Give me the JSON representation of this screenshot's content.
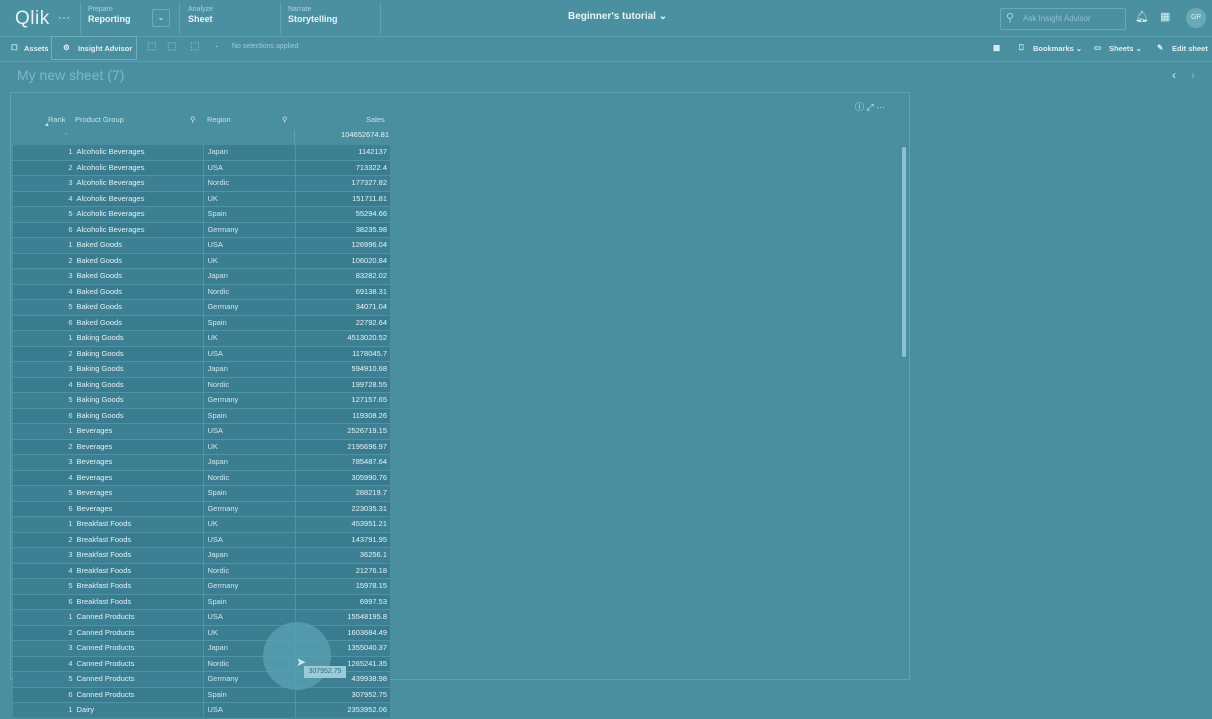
{
  "app": {
    "logo": "Qlik",
    "menu_dots": "···",
    "nav": [
      {
        "small": "Prepare",
        "main": "Reporting"
      },
      {
        "small": "Analyze",
        "main": "Sheet"
      },
      {
        "small": "Narrate",
        "main": "Storytelling"
      }
    ],
    "dropdown_arrow": "⌄",
    "title": "Beginner's tutorial ⌄",
    "search_placeholder": "Ask Insight Advisor",
    "avatar_initials": "GP"
  },
  "toolbar": {
    "assets": "Assets",
    "insight_advisor": "Insight Advisor",
    "no_selections": "No selections applied",
    "bookmarks": "Bookmarks ⌄",
    "sheets": "Sheets ⌄",
    "edit_sheet": "Edit sheet"
  },
  "sheet": {
    "title": "My new sheet (7)"
  },
  "table": {
    "headers": {
      "rank": "Rank",
      "product_group": "Product Group",
      "region": "Region",
      "sales": "Sales"
    },
    "total": "104652674.81",
    "total_dash": "-",
    "rows": [
      [
        "1",
        "Alcoholic Beverages",
        "Japan",
        "1142137"
      ],
      [
        "2",
        "Alcoholic Beverages",
        "USA",
        "713322.4"
      ],
      [
        "3",
        "Alcoholic Beverages",
        "Nordic",
        "177327.82"
      ],
      [
        "4",
        "Alcoholic Beverages",
        "UK",
        "151711.81"
      ],
      [
        "5",
        "Alcoholic Beverages",
        "Spain",
        "55294.66"
      ],
      [
        "6",
        "Alcoholic Beverages",
        "Germany",
        "38235.98"
      ],
      [
        "1",
        "Baked Goods",
        "USA",
        "126996.04"
      ],
      [
        "2",
        "Baked Goods",
        "UK",
        "106020.84"
      ],
      [
        "3",
        "Baked Goods",
        "Japan",
        "83282.02"
      ],
      [
        "4",
        "Baked Goods",
        "Nordic",
        "69138.31"
      ],
      [
        "5",
        "Baked Goods",
        "Germany",
        "34071.04"
      ],
      [
        "6",
        "Baked Goods",
        "Spain",
        "22792.64"
      ],
      [
        "1",
        "Baking Goods",
        "UK",
        "4513020.52"
      ],
      [
        "2",
        "Baking Goods",
        "USA",
        "1178045.7"
      ],
      [
        "3",
        "Baking Goods",
        "Japan",
        "594910.68"
      ],
      [
        "4",
        "Baking Goods",
        "Nordic",
        "199728.55"
      ],
      [
        "5",
        "Baking Goods",
        "Germany",
        "127157.65"
      ],
      [
        "6",
        "Baking Goods",
        "Spain",
        "119308.26"
      ],
      [
        "1",
        "Beverages",
        "USA",
        "2526719.15"
      ],
      [
        "2",
        "Beverages",
        "UK",
        "2195696.97"
      ],
      [
        "3",
        "Beverages",
        "Japan",
        "785487.64"
      ],
      [
        "4",
        "Beverages",
        "Nordic",
        "305990.76"
      ],
      [
        "5",
        "Beverages",
        "Spain",
        "288219.7"
      ],
      [
        "6",
        "Beverages",
        "Germany",
        "223035.31"
      ],
      [
        "1",
        "Breakfast Foods",
        "UK",
        "453951.21"
      ],
      [
        "2",
        "Breakfast Foods",
        "USA",
        "143791.95"
      ],
      [
        "3",
        "Breakfast Foods",
        "Japan",
        "36256.1"
      ],
      [
        "4",
        "Breakfast Foods",
        "Nordic",
        "21276.18"
      ],
      [
        "5",
        "Breakfast Foods",
        "Germany",
        "15978.15"
      ],
      [
        "6",
        "Breakfast Foods",
        "Spain",
        "6997.53"
      ],
      [
        "1",
        "Canned Products",
        "USA",
        "15548195.8"
      ],
      [
        "2",
        "Canned Products",
        "UK",
        "1603684.49"
      ],
      [
        "3",
        "Canned Products",
        "Japan",
        "1355040.37"
      ],
      [
        "4",
        "Canned Products",
        "Nordic",
        "1265241.35"
      ],
      [
        "5",
        "Canned Products",
        "Germany",
        "439938.98"
      ],
      [
        "6",
        "Canned Products",
        "Spain",
        "307952.75"
      ],
      [
        "1",
        "Dairy",
        "USA",
        "2353952.06"
      ]
    ]
  },
  "tooltip": "307952.75"
}
